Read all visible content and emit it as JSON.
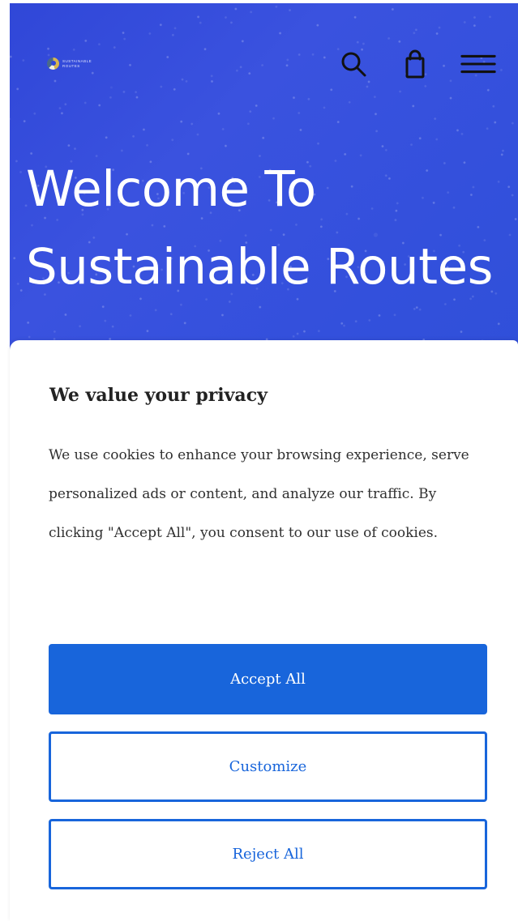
{
  "header": {
    "logo": {
      "line1": "Sustainable",
      "line2": "Routes"
    },
    "icons": {
      "search": "search-icon",
      "bag": "shopping-bag-icon",
      "menu": "hamburger-menu-icon"
    }
  },
  "hero": {
    "title": "Welcome To Sustainable Routes"
  },
  "consent": {
    "title": "We value your privacy",
    "text": "We use cookies to enhance your browsing experience, serve personalized ads or content, and analyze our traffic. By clicking \"Accept All\", you consent to our use of cookies.",
    "buttons": {
      "accept": "Accept All",
      "customize": "Customize",
      "reject": "Reject All"
    }
  },
  "colors": {
    "hero_blue": "#3047d8",
    "button_blue": "#1865db",
    "text_dark": "#222222",
    "white": "#ffffff"
  }
}
